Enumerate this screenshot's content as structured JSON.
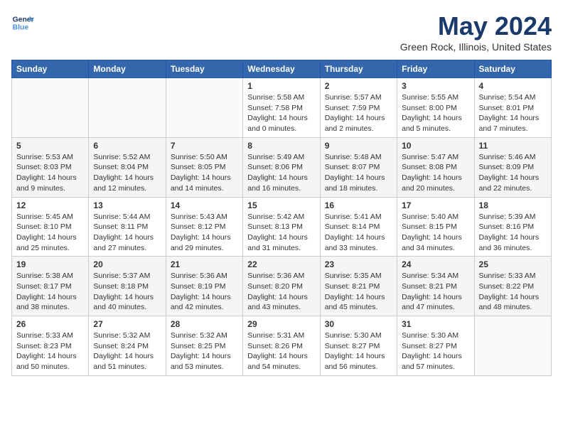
{
  "header": {
    "logo_line1": "General",
    "logo_line2": "Blue",
    "month": "May 2024",
    "location": "Green Rock, Illinois, United States"
  },
  "weekdays": [
    "Sunday",
    "Monday",
    "Tuesday",
    "Wednesday",
    "Thursday",
    "Friday",
    "Saturday"
  ],
  "weeks": [
    [
      {
        "day": "",
        "info": ""
      },
      {
        "day": "",
        "info": ""
      },
      {
        "day": "",
        "info": ""
      },
      {
        "day": "1",
        "info": "Sunrise: 5:58 AM\nSunset: 7:58 PM\nDaylight: 14 hours\nand 0 minutes."
      },
      {
        "day": "2",
        "info": "Sunrise: 5:57 AM\nSunset: 7:59 PM\nDaylight: 14 hours\nand 2 minutes."
      },
      {
        "day": "3",
        "info": "Sunrise: 5:55 AM\nSunset: 8:00 PM\nDaylight: 14 hours\nand 5 minutes."
      },
      {
        "day": "4",
        "info": "Sunrise: 5:54 AM\nSunset: 8:01 PM\nDaylight: 14 hours\nand 7 minutes."
      }
    ],
    [
      {
        "day": "5",
        "info": "Sunrise: 5:53 AM\nSunset: 8:03 PM\nDaylight: 14 hours\nand 9 minutes."
      },
      {
        "day": "6",
        "info": "Sunrise: 5:52 AM\nSunset: 8:04 PM\nDaylight: 14 hours\nand 12 minutes."
      },
      {
        "day": "7",
        "info": "Sunrise: 5:50 AM\nSunset: 8:05 PM\nDaylight: 14 hours\nand 14 minutes."
      },
      {
        "day": "8",
        "info": "Sunrise: 5:49 AM\nSunset: 8:06 PM\nDaylight: 14 hours\nand 16 minutes."
      },
      {
        "day": "9",
        "info": "Sunrise: 5:48 AM\nSunset: 8:07 PM\nDaylight: 14 hours\nand 18 minutes."
      },
      {
        "day": "10",
        "info": "Sunrise: 5:47 AM\nSunset: 8:08 PM\nDaylight: 14 hours\nand 20 minutes."
      },
      {
        "day": "11",
        "info": "Sunrise: 5:46 AM\nSunset: 8:09 PM\nDaylight: 14 hours\nand 22 minutes."
      }
    ],
    [
      {
        "day": "12",
        "info": "Sunrise: 5:45 AM\nSunset: 8:10 PM\nDaylight: 14 hours\nand 25 minutes."
      },
      {
        "day": "13",
        "info": "Sunrise: 5:44 AM\nSunset: 8:11 PM\nDaylight: 14 hours\nand 27 minutes."
      },
      {
        "day": "14",
        "info": "Sunrise: 5:43 AM\nSunset: 8:12 PM\nDaylight: 14 hours\nand 29 minutes."
      },
      {
        "day": "15",
        "info": "Sunrise: 5:42 AM\nSunset: 8:13 PM\nDaylight: 14 hours\nand 31 minutes."
      },
      {
        "day": "16",
        "info": "Sunrise: 5:41 AM\nSunset: 8:14 PM\nDaylight: 14 hours\nand 33 minutes."
      },
      {
        "day": "17",
        "info": "Sunrise: 5:40 AM\nSunset: 8:15 PM\nDaylight: 14 hours\nand 34 minutes."
      },
      {
        "day": "18",
        "info": "Sunrise: 5:39 AM\nSunset: 8:16 PM\nDaylight: 14 hours\nand 36 minutes."
      }
    ],
    [
      {
        "day": "19",
        "info": "Sunrise: 5:38 AM\nSunset: 8:17 PM\nDaylight: 14 hours\nand 38 minutes."
      },
      {
        "day": "20",
        "info": "Sunrise: 5:37 AM\nSunset: 8:18 PM\nDaylight: 14 hours\nand 40 minutes."
      },
      {
        "day": "21",
        "info": "Sunrise: 5:36 AM\nSunset: 8:19 PM\nDaylight: 14 hours\nand 42 minutes."
      },
      {
        "day": "22",
        "info": "Sunrise: 5:36 AM\nSunset: 8:20 PM\nDaylight: 14 hours\nand 43 minutes."
      },
      {
        "day": "23",
        "info": "Sunrise: 5:35 AM\nSunset: 8:21 PM\nDaylight: 14 hours\nand 45 minutes."
      },
      {
        "day": "24",
        "info": "Sunrise: 5:34 AM\nSunset: 8:21 PM\nDaylight: 14 hours\nand 47 minutes."
      },
      {
        "day": "25",
        "info": "Sunrise: 5:33 AM\nSunset: 8:22 PM\nDaylight: 14 hours\nand 48 minutes."
      }
    ],
    [
      {
        "day": "26",
        "info": "Sunrise: 5:33 AM\nSunset: 8:23 PM\nDaylight: 14 hours\nand 50 minutes."
      },
      {
        "day": "27",
        "info": "Sunrise: 5:32 AM\nSunset: 8:24 PM\nDaylight: 14 hours\nand 51 minutes."
      },
      {
        "day": "28",
        "info": "Sunrise: 5:32 AM\nSunset: 8:25 PM\nDaylight: 14 hours\nand 53 minutes."
      },
      {
        "day": "29",
        "info": "Sunrise: 5:31 AM\nSunset: 8:26 PM\nDaylight: 14 hours\nand 54 minutes."
      },
      {
        "day": "30",
        "info": "Sunrise: 5:30 AM\nSunset: 8:27 PM\nDaylight: 14 hours\nand 56 minutes."
      },
      {
        "day": "31",
        "info": "Sunrise: 5:30 AM\nSunset: 8:27 PM\nDaylight: 14 hours\nand 57 minutes."
      },
      {
        "day": "",
        "info": ""
      }
    ]
  ]
}
